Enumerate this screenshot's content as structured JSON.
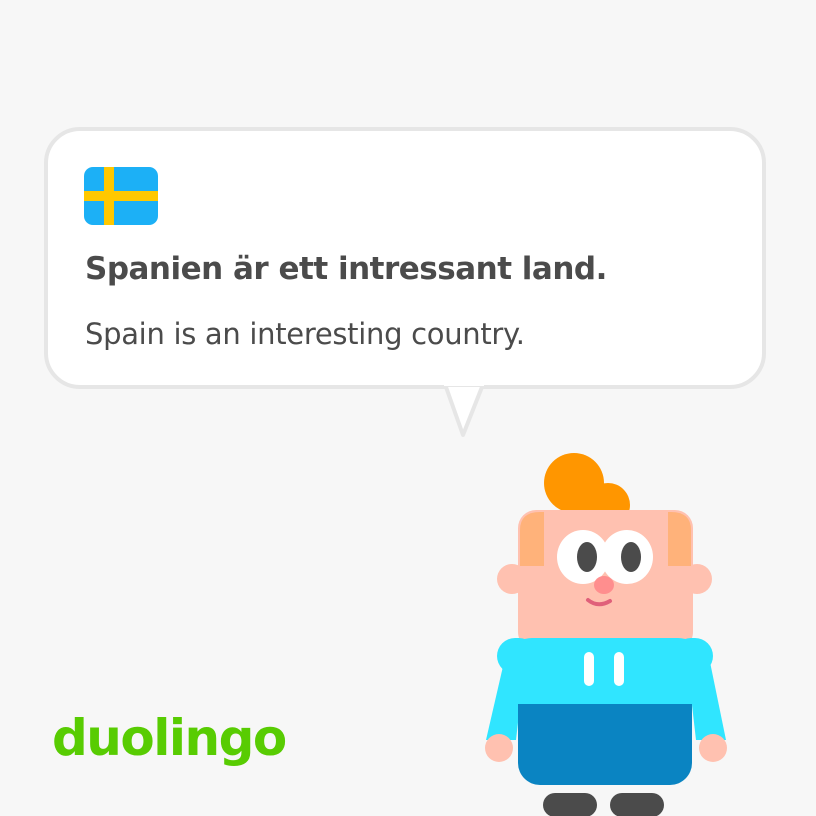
{
  "card": {
    "language_flag": "sweden-flag",
    "sentence": "Spanien är ett intressant land.",
    "translation": "Spain is an interesting country."
  },
  "brand": {
    "logo_text": "duolingo"
  },
  "character": {
    "name": "duolingo-character-icon"
  },
  "colors": {
    "background": "#f7f7f7",
    "bubble_fill": "#ffffff",
    "bubble_border": "#e6e6e6",
    "text": "#4b4b4b",
    "brand_green": "#58cc02",
    "flag_blue": "#1cb0f6",
    "flag_yellow": "#ffc800",
    "hair": "#ff9600",
    "skin": "#ffc1b0",
    "shirt_light": "#30e5ff",
    "shirt_dark": "#0a84c2"
  }
}
